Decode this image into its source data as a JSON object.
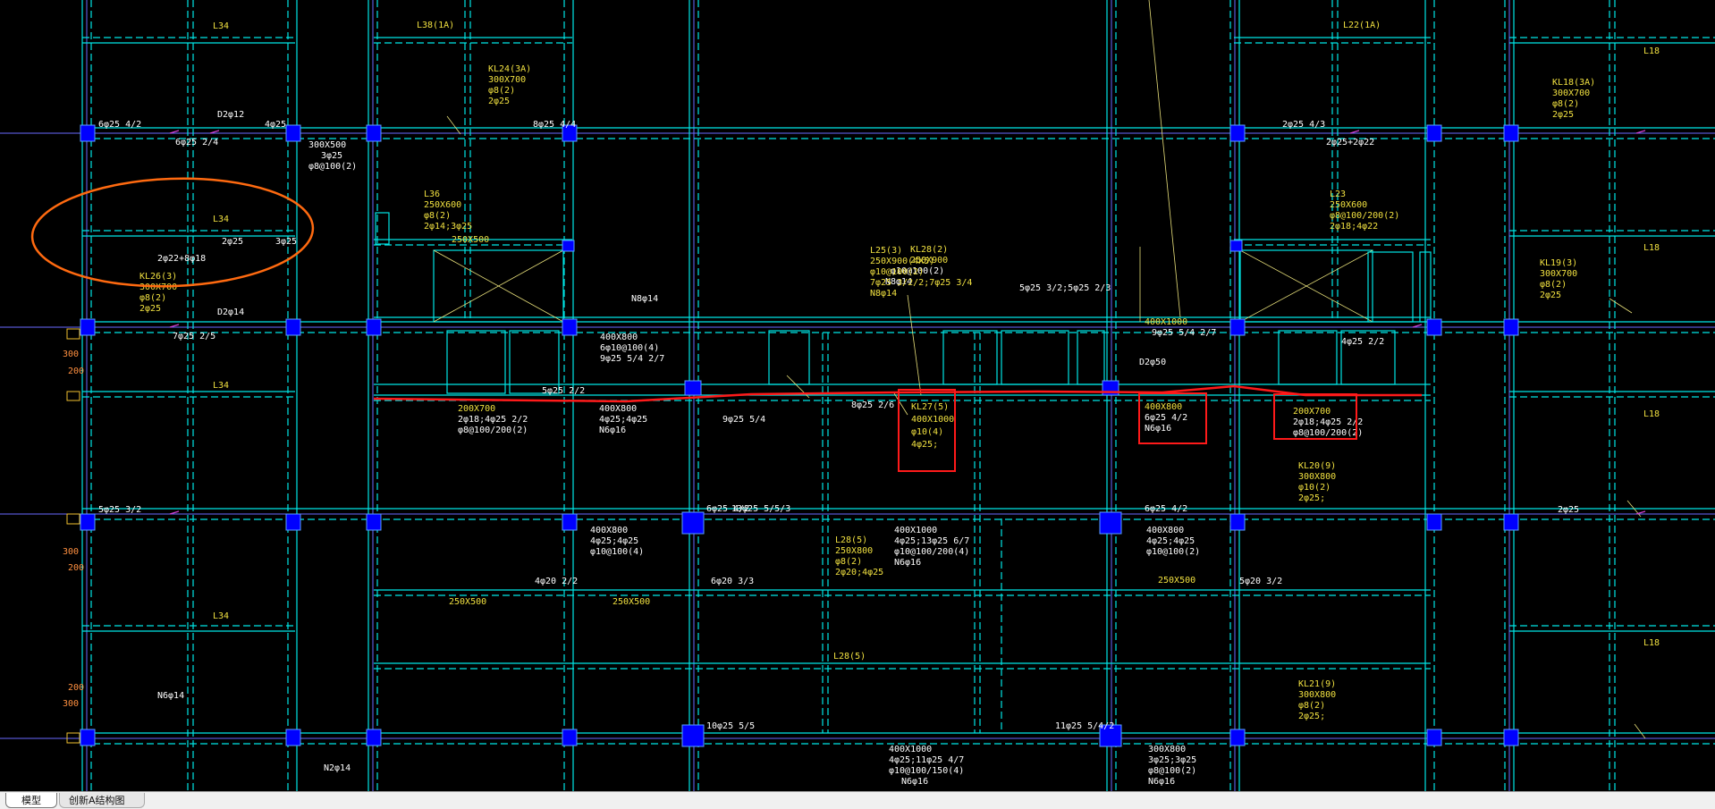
{
  "colors": {
    "background": "#000000",
    "beam_edge": "#00e5e5",
    "text_white": "#ffffff",
    "text_yellow": "#f0e040",
    "column_fill": "#0000ff",
    "axis_line": "#6a6aff",
    "markup_red": "#ff1a1a",
    "markup_orange": "#ff6a10"
  },
  "tabs": {
    "model": "模型",
    "layout": "创新A结构图"
  },
  "beam_labels": {
    "kl27": [
      "KL27(5)",
      "400X1000",
      "φ10(4)",
      "4φ25;"
    ],
    "kl28": [
      "KL28(2)",
      "250X900",
      "φ10@100(2)",
      "N8φ14"
    ],
    "l25": [
      "L25(3)",
      "250X900(4X5)",
      "φ10@100(2)",
      "7φ25 3/2/2;7φ25 3/4",
      "N8φ14"
    ],
    "l36": [
      "L36",
      "250X600",
      "φ8(2)",
      "2φ14;3φ25"
    ],
    "l23": [
      "L23",
      "250X600",
      "φ8@100/200(2)",
      "2φ18;4φ22"
    ],
    "kl26": [
      "KL26(3)",
      "300X700",
      "φ8(2)",
      "2φ25"
    ],
    "kl24": [
      "KL24(3A)",
      "300X700",
      "φ8(2)",
      "2φ25"
    ],
    "kl19": [
      "KL19(3)",
      "300X700",
      "φ8(2)",
      "2φ25"
    ],
    "kl18": [
      "KL18(3A)",
      "300X700",
      "φ8(2)",
      "2φ25"
    ],
    "l38": "L38(1A)",
    "l22": "L22(1A)",
    "l34a": "L34",
    "l34b": "L34",
    "l34c": "L34",
    "l34d": "L34",
    "l18a": "L18",
    "l18b": "L18",
    "l18c": "L18",
    "l18d": "L18",
    "l28": [
      "L28(5)",
      "250X800",
      "φ8(2)",
      "2φ20;4φ25"
    ],
    "l28b": "L28(5)",
    "kl20": [
      "KL20(9)",
      "300X800",
      "φ10(2)",
      "2φ25;"
    ],
    "kl21": [
      "KL21(9)",
      "300X800",
      "φ8(2)",
      "2φ25;"
    ],
    "box_400x800": [
      "400X800",
      "6φ25 4/2",
      "N6φ16"
    ],
    "box_200x700": [
      "200X700",
      "2φ18;4φ25 2/2",
      "φ8@100/200(2)"
    ],
    "b200x700_left": [
      "200X700",
      "2φ18;4φ25 2/2",
      "φ8@100/200(2)"
    ],
    "b400x800_left": [
      "400X800",
      "4φ25;4φ25",
      "N6φ16"
    ],
    "b400x1000": [
      "400X1000",
      "4φ25;13φ25 6/7",
      "φ10@100/200(4)",
      "N6φ16"
    ],
    "b400x800_mid": [
      "400X800",
      "4φ25;4φ25",
      "φ10@100(4)"
    ],
    "b400x800_right": [
      "400X800",
      "4φ25;4φ25",
      "φ10@100(2)"
    ],
    "b400x1000_bot": [
      "400X1000",
      "4φ25;11φ25 4/7",
      "φ10@100/150(4)",
      "N6φ16"
    ],
    "b300x800_bot": [
      "300X800",
      "3φ25;3φ25",
      "φ8@100(2)",
      "N6φ16"
    ],
    "b300x500": [
      "300X500",
      "3φ25",
      "φ8@100(2)"
    ],
    "b250x500a": "250X500",
    "b250x500b": "250X500",
    "b250x500c": "250X500",
    "b250x500d": "250X500",
    "b400x1000_top": "400X1000",
    "b400x800_top": [
      "400X800",
      "6φ10@100(4)",
      "9φ25 5/4 2/7"
    ],
    "misc": [
      "6φ25 4/2",
      "6φ25 2/4",
      "4φ25",
      "2φ25",
      "3φ25",
      "D2φ12",
      "D2φ14",
      "7φ25 2/5",
      "5φ25 3/2",
      "6φ25 4/2",
      "13φ25 5/5/3",
      "10φ25 5/5",
      "11φ25 5/4/2",
      "8φ25 4/4",
      "2φ22+8φ18",
      "4φ20 2/2",
      "6φ20 3/3",
      "5φ20 3/2",
      "N6φ14",
      "N8φ14",
      "N2φ14",
      "6φ25 4/2",
      "2φ25 4/3",
      "2φ25+2φ22",
      "4φ25 2/2",
      "9φ25 5/4",
      "8φ25 2/6",
      "5φ25 2/2",
      "5φ25 3/2;5φ25 2/3",
      "9φ25 5/4 2/7",
      "D2φ50",
      "2φ25"
    ],
    "dims": [
      "300",
      "200",
      "300",
      "200",
      "200",
      "300"
    ]
  }
}
